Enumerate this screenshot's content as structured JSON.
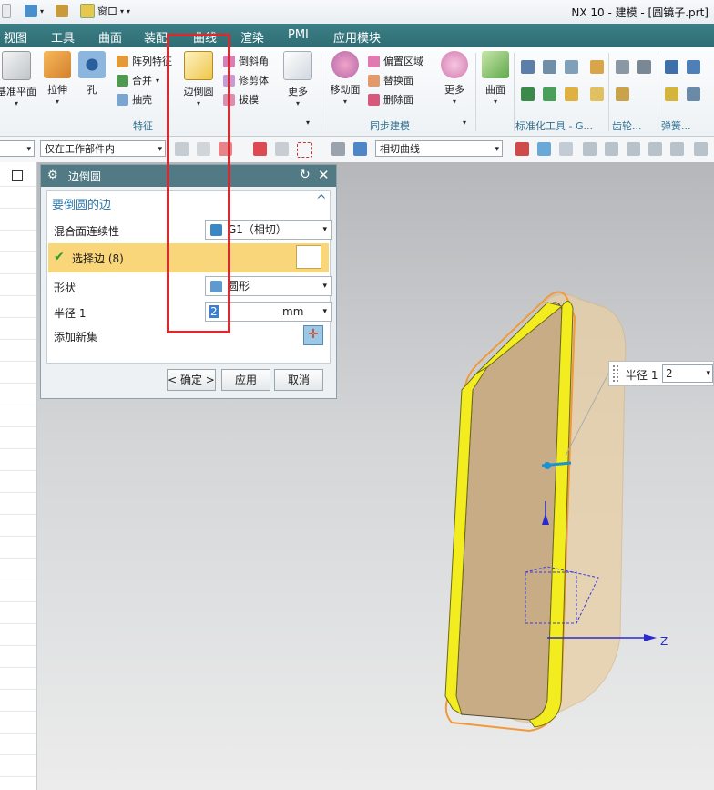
{
  "window": {
    "title": "NX 10 - 建模 - [圆镜子.prt]"
  },
  "quick_access": {
    "window_menu": "窗口"
  },
  "menu_tabs": [
    "视图",
    "工具",
    "曲面",
    "装配",
    "曲线",
    "渲染",
    "PMI",
    "应用模块"
  ],
  "ribbon": {
    "datum_plane": "基准平面",
    "extrude": "拉伸",
    "hole": "孔",
    "pattern_feature": "阵列特征",
    "unite": "合并",
    "shell": "抽壳",
    "edge_blend": "边倒圆",
    "chamfer": "倒斜角",
    "trim_body": "修剪体",
    "draft": "拔模",
    "more_feature": "更多",
    "feature_group": "特征",
    "move_face": "移动面",
    "offset_region": "偏置区域",
    "replace_face": "替换面",
    "delete_face": "删除面",
    "more_sync": "更多",
    "sync_group": "同步建模",
    "surface": "曲面",
    "std_tools_group": "标准化工具 - G...",
    "gear_group": "齿轮...",
    "spring_group": "弹簧..."
  },
  "toolbar": {
    "scope_filter": "仅在工作部件内",
    "curve_rule": "相切曲线"
  },
  "dialog": {
    "title": "边倒圆",
    "section": "要倒圆的边",
    "continuity_label": "混合面连续性",
    "continuity_value": "G1（相切）",
    "select_edge": "选择边 (8)",
    "shape_label": "形状",
    "shape_value": "圆形",
    "radius_label": "半径 1",
    "radius_value": "2",
    "radius_unit": "mm",
    "add_new_set": "添加新集",
    "ok": "< 确定 >",
    "apply": "应用",
    "cancel": "取消"
  },
  "callout": {
    "label": "半径 1",
    "value": "2"
  },
  "axis": {
    "z_label": "Z"
  },
  "colors": {
    "menu_bg": "#2f6d74",
    "dialog_title_bg": "#527a84",
    "selection_bg": "#f9d67a",
    "highlight_red": "#e0272d",
    "edge_yellow": "#f3ec1e"
  }
}
